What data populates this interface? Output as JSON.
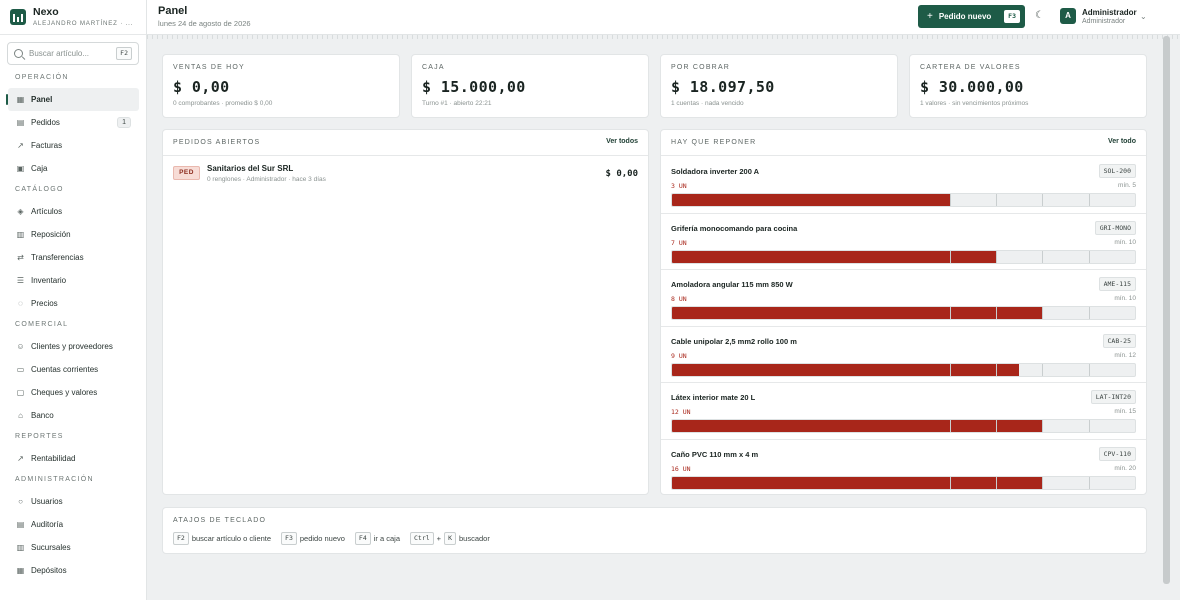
{
  "brand": {
    "name": "Nexo",
    "user": "ALEJANDRO MARTÍNEZ · ..."
  },
  "search": {
    "placeholder": "Buscar artículo...",
    "shortcut": "F2"
  },
  "sidebar": {
    "sections": [
      {
        "title": "Operación",
        "items": [
          {
            "label": "Panel",
            "icon": "grid-icon",
            "active": true
          },
          {
            "label": "Pedidos",
            "icon": "document-icon",
            "count": "1"
          },
          {
            "label": "Facturas",
            "icon": "chart-line-icon"
          },
          {
            "label": "Caja",
            "icon": "box-icon"
          }
        ]
      },
      {
        "title": "Catálogo",
        "items": [
          {
            "label": "Artículos",
            "icon": "cube-icon"
          },
          {
            "label": "Reposición",
            "icon": "bar-chart-icon"
          },
          {
            "label": "Transferencias",
            "icon": "arrows-icon"
          },
          {
            "label": "Inventario",
            "icon": "list-icon"
          },
          {
            "label": "Precios",
            "icon": "tag-icon"
          }
        ]
      },
      {
        "title": "Comercial",
        "items": [
          {
            "label": "Clientes y proveedores",
            "icon": "users-icon"
          },
          {
            "label": "Cuentas corrientes",
            "icon": "card-icon"
          },
          {
            "label": "Cheques y valores",
            "icon": "check-icon"
          },
          {
            "label": "Banco",
            "icon": "bank-icon"
          }
        ]
      },
      {
        "title": "Reportes",
        "items": [
          {
            "label": "Rentabilidad",
            "icon": "trend-icon"
          }
        ]
      },
      {
        "title": "Administración",
        "items": [
          {
            "label": "Usuarios",
            "icon": "user-icon"
          },
          {
            "label": "Auditoría",
            "icon": "audit-icon"
          },
          {
            "label": "Sucursales",
            "icon": "building-icon"
          },
          {
            "label": "Depósitos",
            "icon": "warehouse-icon"
          }
        ]
      }
    ]
  },
  "header": {
    "title": "Panel",
    "date": "lunes 24 de agosto de 2026",
    "new_order_label": "Pedido nuevo",
    "new_order_shortcut": "F3",
    "user_initial": "A",
    "user_name": "Administrador",
    "user_role": "Administrador"
  },
  "kpis": [
    {
      "label": "Ventas de hoy",
      "value": "$ 0,00",
      "sub": "0 comprobantes · promedio $ 0,00"
    },
    {
      "label": "Caja",
      "value": "$ 15.000,00",
      "sub": "Turno #1 · abierto 22:21"
    },
    {
      "label": "Por cobrar",
      "value": "$ 18.097,50",
      "sub": "1 cuentas · nada vencido"
    },
    {
      "label": "Cartera de valores",
      "value": "$ 30.000,00",
      "sub": "1 valores · sin vencimientos próximos"
    }
  ],
  "open_orders": {
    "title": "Pedidos abiertos",
    "link": "Ver todos",
    "rows": [
      {
        "badge": "PED",
        "name": "Sanitarios del Sur SRL",
        "meta": "0 renglones · Administrador · hace 3 días",
        "amount": "$ 0,00"
      }
    ]
  },
  "restock": {
    "title": "Hay que reponer",
    "link": "Ver todo",
    "rows": [
      {
        "name": "Soldadora inverter 200 A",
        "code": "SOL-200",
        "qty": "3 UN",
        "min": "mín. 5",
        "level": 0.6
      },
      {
        "name": "Grifería monocomando para cocina",
        "code": "GRI-MONO",
        "qty": "7 UN",
        "min": "mín. 10",
        "level": 0.7
      },
      {
        "name": "Amoladora angular 115 mm 850 W",
        "code": "AME-115",
        "qty": "8 UN",
        "min": "mín. 10",
        "level": 0.8
      },
      {
        "name": "Cable unipolar 2,5 mm2 rollo 100 m",
        "code": "CAB-25",
        "qty": "9 UN",
        "min": "mín. 12",
        "level": 0.75
      },
      {
        "name": "Látex interior mate 20 L",
        "code": "LAT-INT20",
        "qty": "12 UN",
        "min": "mín. 15",
        "level": 0.8
      },
      {
        "name": "Caño PVC 110 mm x 4 m",
        "code": "CPV-110",
        "qty": "16 UN",
        "min": "mín. 20",
        "level": 0.8
      }
    ]
  },
  "shortcuts": {
    "title": "Atajos de teclado",
    "items": [
      {
        "keys": [
          "F2"
        ],
        "label": "buscar artículo o cliente"
      },
      {
        "keys": [
          "F3"
        ],
        "label": "pedido nuevo"
      },
      {
        "keys": [
          "F4"
        ],
        "label": "ir a caja"
      },
      {
        "keys": [
          "Ctrl",
          "K"
        ],
        "label": "buscador"
      }
    ]
  },
  "colors": {
    "accent": "#1e5b47",
    "danger": "#a8261a"
  }
}
